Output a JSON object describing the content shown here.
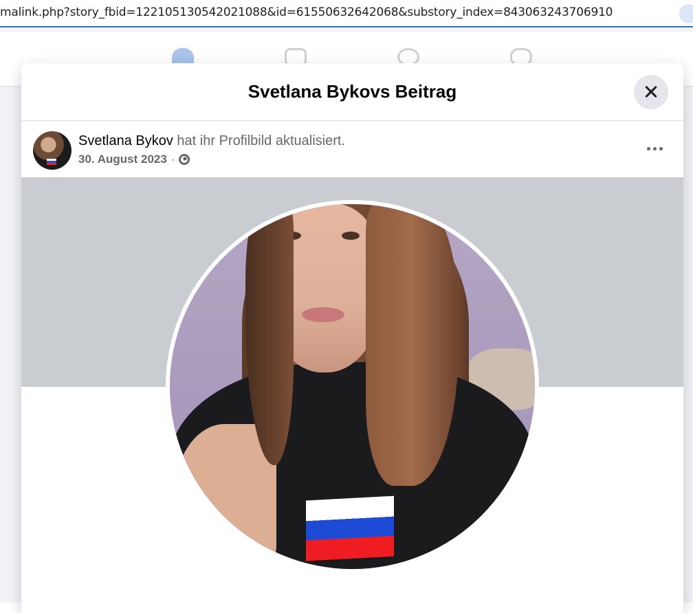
{
  "browser": {
    "url": "malink.php?story_fbid=122105130542021088&id=61550632642068&substory_index=843063243706910"
  },
  "modal": {
    "title": "Svetlana Bykovs Beitrag"
  },
  "post": {
    "author": "Svetlana Bykov",
    "action": "hat ihr Profilbild aktualisiert.",
    "date": "30. August 2023",
    "separator": "·",
    "privacy_icon": "globe-icon"
  },
  "colors": {
    "accent": "#1877f2",
    "cover": "#c9ccd1",
    "close_bg": "#e4e6eb"
  }
}
